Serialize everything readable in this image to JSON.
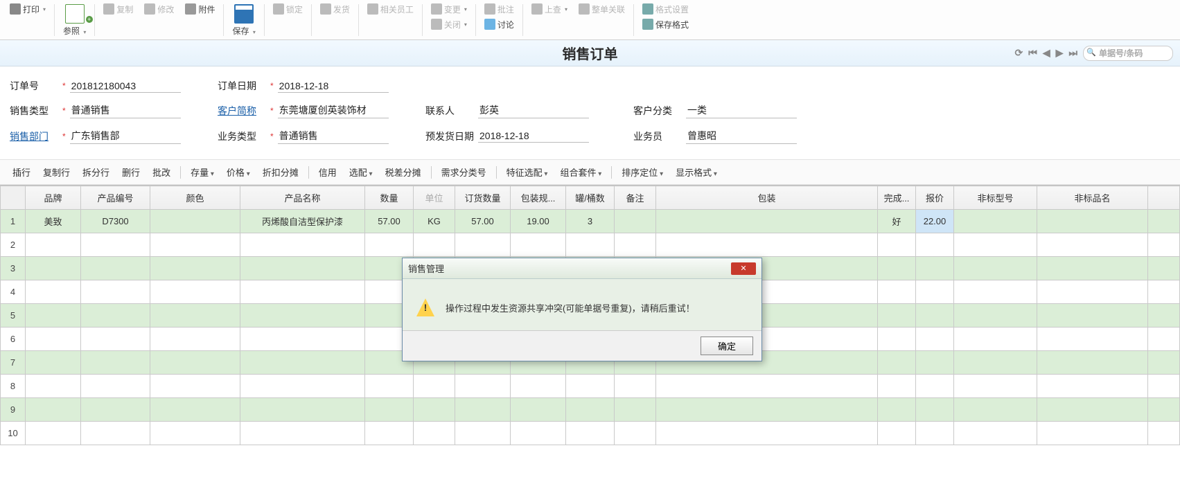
{
  "toolbar": {
    "print": "打印",
    "reference": "参照",
    "copy": "复制",
    "edit": "修改",
    "attachment": "附件",
    "save": "保存",
    "lock": "锁定",
    "ship": "发货",
    "related_emp": "相关员工",
    "change": "变更",
    "close": "关闭",
    "approve": "批注",
    "discuss": "讨论",
    "lookup": "上查",
    "link_all": "整单关联",
    "format_settings": "格式设置",
    "save_format": "保存格式"
  },
  "title": "销售订单",
  "search_placeholder": "单据号/条码",
  "form": {
    "order_no": {
      "label": "订单号",
      "value": "201812180043"
    },
    "order_date": {
      "label": "订单日期",
      "value": "2018-12-18"
    },
    "sale_type": {
      "label": "销售类型",
      "value": "普通销售"
    },
    "customer": {
      "label": "客户简称",
      "value": "东莞塘厦创英装饰材"
    },
    "contact": {
      "label": "联系人",
      "value": "彭英"
    },
    "cust_class": {
      "label": "客户分类",
      "value": "一类"
    },
    "dept": {
      "label": "销售部门",
      "value": "广东销售部"
    },
    "biz_type": {
      "label": "业务类型",
      "value": "普通销售"
    },
    "pre_ship": {
      "label": "预发货日期",
      "value": "2018-12-18"
    },
    "salesman": {
      "label": "业务员",
      "value": "曾惠昭"
    }
  },
  "actions": {
    "insert_row": "插行",
    "copy_row": "复制行",
    "split_row": "拆分行",
    "delete_row": "删行",
    "batch": "批改",
    "stock": "存量",
    "price": "价格",
    "discount": "折扣分摊",
    "credit": "信用",
    "match": "选配",
    "tax_diff": "税差分摊",
    "demand_no": "需求分类号",
    "feature": "特征选配",
    "combo": "组合套件",
    "sort": "排序定位",
    "display": "显示格式"
  },
  "columns": {
    "brand": "品牌",
    "code": "产品编号",
    "color": "颜色",
    "name": "产品名称",
    "qty": "数量",
    "unit": "单位",
    "order_qty": "订货数量",
    "pack_spec": "包装规...",
    "cans": "罐/桶数",
    "remark": "备注",
    "packaging": "包装",
    "done": "完成...",
    "price": "报价",
    "nonstd_model": "非标型号",
    "nonstd_name": "非标品名"
  },
  "rows": [
    {
      "brand": "美致",
      "code": "D7300",
      "color": "",
      "name": "丙烯酸自洁型保护漆",
      "qty": "57.00",
      "unit": "KG",
      "order_qty": "57.00",
      "pack_spec": "19.00",
      "cans": "3",
      "remark": "",
      "packaging": "",
      "done": "好",
      "price": "22.00",
      "nonstd_model": "",
      "nonstd_name": ""
    }
  ],
  "dialog": {
    "title": "销售管理",
    "message": "操作过程中发生资源共享冲突(可能单据号重复)，请稍后重试！",
    "ok": "确定"
  }
}
